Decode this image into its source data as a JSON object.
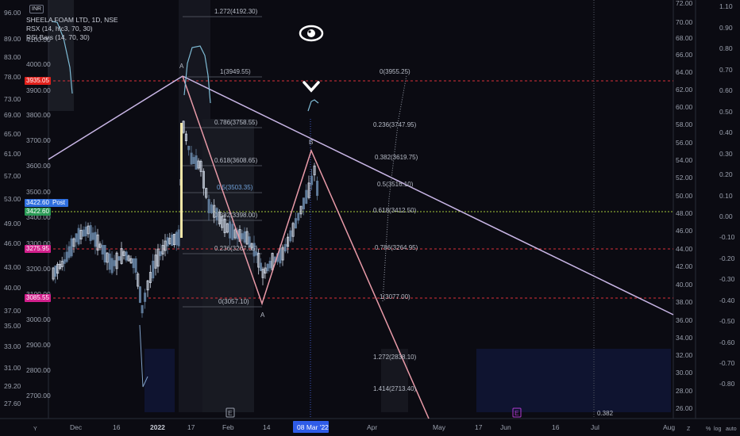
{
  "symbol": {
    "title": "SHEELA FOAM LTD, 1D, NSE",
    "currency": "INR",
    "indicator_1": "RSX (14, hlc3, 70, 30)",
    "indicator_2": "RSI Bars (14, 70, 30)"
  },
  "price_axis_left": [
    "96.00",
    "89.00",
    "83.00",
    "78.00",
    "73.00",
    "69.00",
    "65.00",
    "61.00",
    "57.00",
    "53.00",
    "49.00",
    "46.00",
    "43.00",
    "40.00",
    "37.00",
    "35.00",
    "33.00",
    "31.00",
    "29.20",
    "27.60"
  ],
  "price_axis_main": [
    "4100.00",
    "4000.00",
    "3900.00",
    "3800.00",
    "3700.00",
    "3600.00",
    "3500.00",
    "3400.00",
    "3300.00",
    "3200.00",
    "3100.00",
    "3000.00",
    "2900.00",
    "2800.00",
    "2700.00"
  ],
  "rsx_axis": [
    "72.00",
    "70.00",
    "68.00",
    "66.00",
    "64.00",
    "62.00",
    "60.00",
    "58.00",
    "56.00",
    "54.00",
    "52.00",
    "50.00",
    "48.00",
    "46.00",
    "44.00",
    "42.00",
    "40.00",
    "38.00",
    "36.00",
    "34.00",
    "32.00",
    "30.00",
    "28.00",
    "26.00"
  ],
  "osc_axis": [
    "1.10",
    "0.90",
    "0.80",
    "0.70",
    "0.60",
    "0.50",
    "0.40",
    "0.30",
    "0.20",
    "0.10",
    "0.00",
    "-0.10",
    "-0.20",
    "-0.30",
    "-0.40",
    "-0.50",
    "-0.60",
    "-0.70",
    "-0.80"
  ],
  "time_axis": [
    "Dec",
    "16",
    "2022",
    "17",
    "Feb",
    "14",
    "Apr",
    "May",
    "17",
    "Jun",
    "16",
    "Jul",
    "Aug"
  ],
  "time_highlight": "08 Mar '22",
  "price_tags": [
    {
      "label": "3935.05",
      "color": "#e0201b"
    },
    {
      "label": "3422.60",
      "color": "#2f6fe0"
    },
    {
      "label": "3422.60",
      "color": "#2a9a55"
    },
    {
      "label": "3275.95",
      "color": "#d21f8c"
    },
    {
      "label": "3085.55",
      "color": "#d21f8c"
    }
  ],
  "post_label": "Post",
  "fib_left": [
    "1.272(4192.30)",
    "1(3949.55)",
    "0.786(3758.55)",
    "0.618(3608.65)",
    "0.5(3503.35)",
    "0.382(3398.00)",
    "0.236(3267.55)",
    "0(3057.10)"
  ],
  "fib_right": [
    "0(3955.25)",
    "0.236(3747.95)",
    "0.382(3619.75)",
    "0.5(3516.10)",
    "0.618(3412.50)",
    "0.786(3264.95)",
    "1(3077.00)",
    "1.272(2838.10)",
    "1.414(2713.40)"
  ],
  "pattern_labels": [
    "A",
    "B",
    "A"
  ],
  "right_label": "0.382",
  "event_marks": [
    "E",
    "E"
  ],
  "bottom_icons": [
    "Y",
    "Z",
    "%",
    "log",
    "auto"
  ],
  "colors": {
    "bg": "#0b0b12",
    "trend": "#c9b6e6",
    "leg": "#e89aa8",
    "fib_red": "#d8303a",
    "fib_green": "#a6c83a",
    "up": "#cfd8e6",
    "down": "#5f7a99"
  }
}
